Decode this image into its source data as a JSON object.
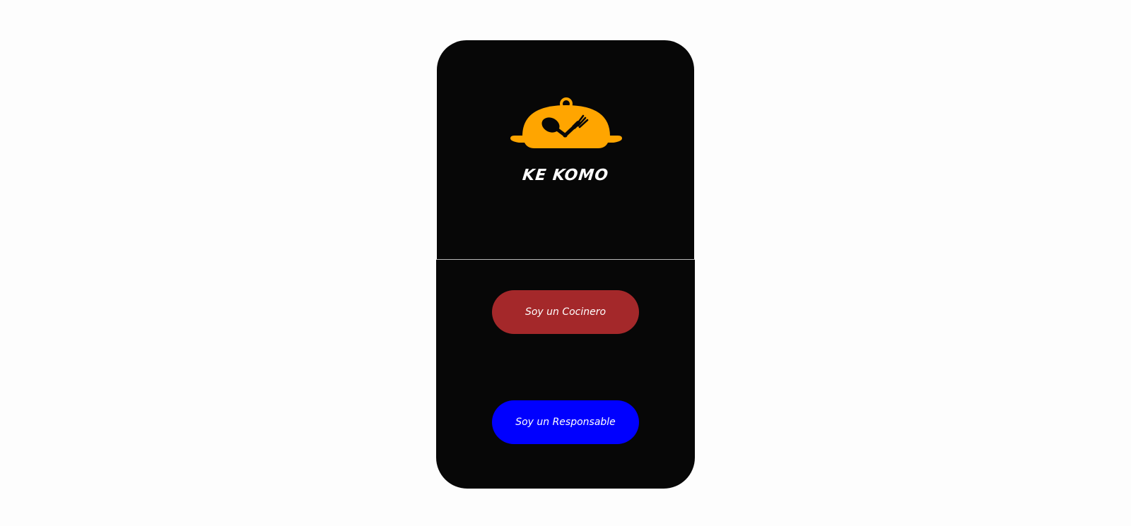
{
  "app": {
    "brand_name": "KE KOMO",
    "logo_icon": "food-cloche-icon"
  },
  "actions": {
    "cook_button_label": "Soy un Cocinero",
    "responsible_button_label": "Soy un Responsable"
  },
  "colors": {
    "page_background": "#fdfdfd",
    "card_background": "#070707",
    "logo_accent": "#ffa500",
    "cook_button": "#a4282a",
    "responsible_button": "#0000ff",
    "button_text": "#ffffff"
  }
}
